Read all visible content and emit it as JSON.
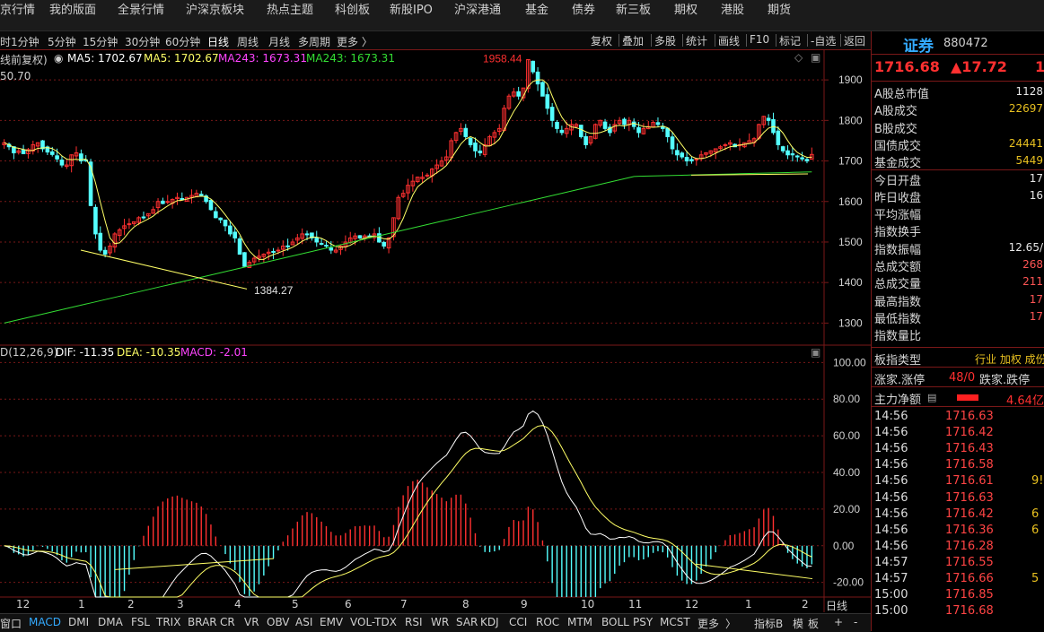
{
  "top_nav": [
    "京行情",
    "我的版面",
    "全景行情",
    "沪深京板块",
    "热点主题",
    "科创板",
    "新股IPO",
    "沪深港通",
    "基金",
    "债券",
    "新三板",
    "期权",
    "港股",
    "期货"
  ],
  "periods": [
    "时",
    "1分钟",
    "5分钟",
    "15分钟",
    "30分钟",
    "60分钟",
    "日线",
    "周线",
    "月线",
    "多周期",
    "更多 〉"
  ],
  "active_period": "日线",
  "tools": [
    "复权",
    "叠加",
    "多股",
    "统计",
    "画线",
    "F10",
    "标记",
    "-自选",
    "返回"
  ],
  "legend": {
    "fq": "线前复权)",
    "ma5a": "MA5: 1702.67",
    "ma5b": "MA5: 1702.67",
    "ma243a": "MA243: 1673.31",
    "ma243b": "MA243: 1673.31",
    "top_value": "50.70",
    "high_mark": "1958.44",
    "low_mark": "1384.27"
  },
  "macd_legend": {
    "name": "D(12,26,9)",
    "dif": "DIF: -11.35",
    "dea": "DEA: -10.35",
    "macd": "MACD: -2.01"
  },
  "price_axis": [
    "1900",
    "1800",
    "1700",
    "1600",
    "1500",
    "1400",
    "1300"
  ],
  "macd_axis": [
    "100.00",
    "80.00",
    "60.00",
    "40.00",
    "20.00",
    "0.00",
    "-20.00"
  ],
  "x_labels": [
    "12",
    "1",
    "2",
    "3",
    "4",
    "5",
    "6",
    "7",
    "8",
    "9",
    "10",
    "11",
    "12",
    "1",
    "2"
  ],
  "right_panel": {
    "name": "证券",
    "code": "880472",
    "price": "1716.68",
    "change": "▲17.72",
    "change_pct": "1",
    "rows": [
      {
        "label": "A股总市值",
        "value": "1128"
      },
      {
        "label": "A股成交",
        "value": "22697"
      },
      {
        "label": "B股成交",
        "value": ""
      },
      {
        "label": "国债成交",
        "value": "24441"
      },
      {
        "label": "基金成交",
        "value": "5449"
      },
      {
        "label": "今日开盘",
        "value": "17"
      },
      {
        "label": "昨日收盘",
        "value": "16"
      },
      {
        "label": "平均涨幅",
        "value": ""
      },
      {
        "label": "指数换手",
        "value": ""
      },
      {
        "label": "指数振幅",
        "value": "12.65/"
      },
      {
        "label": "总成交额",
        "value": "268"
      },
      {
        "label": "总成交量",
        "value": "211"
      },
      {
        "label": "最高指数",
        "value": "17"
      },
      {
        "label": "最低指数",
        "value": "17"
      },
      {
        "label": "指数量比",
        "value": ""
      }
    ],
    "sector_type_label": "板指类型",
    "sector_type_value": "行业 加权 成份",
    "up_label": "涨家.涨停",
    "up_value": "48/0",
    "down_label": "跌家.跌停",
    "netflow_label": "主力净额",
    "netflow_value": "4.64亿",
    "ticks": [
      {
        "time": "14:56",
        "price": "1716.63",
        "vol": ""
      },
      {
        "time": "14:56",
        "price": "1716.42",
        "vol": ""
      },
      {
        "time": "14:56",
        "price": "1716.43",
        "vol": ""
      },
      {
        "time": "14:56",
        "price": "1716.58",
        "vol": ""
      },
      {
        "time": "14:56",
        "price": "1716.61",
        "vol": "9!"
      },
      {
        "time": "14:56",
        "price": "1716.63",
        "vol": ""
      },
      {
        "time": "14:56",
        "price": "1716.42",
        "vol": "6"
      },
      {
        "time": "14:56",
        "price": "1716.36",
        "vol": "6"
      },
      {
        "time": "14:56",
        "price": "1716.28",
        "vol": ""
      },
      {
        "time": "14:57",
        "price": "1716.55",
        "vol": ""
      },
      {
        "time": "14:57",
        "price": "1716.66",
        "vol": "5"
      },
      {
        "time": "15:00",
        "price": "1716.85",
        "vol": ""
      },
      {
        "time": "15:00",
        "price": "1716.68",
        "vol": ""
      }
    ]
  },
  "bottom_tabs": [
    "窗口",
    "MACD",
    "DMI",
    "DMA",
    "FSL",
    "TRIX",
    "BRAR",
    "CR",
    "VR",
    "OBV",
    "ASI",
    "EMV",
    "VOL-TDX",
    "RSI",
    "WR",
    "SAR",
    "KDJ",
    "CCI",
    "ROC",
    "MTM",
    "BOLL",
    "PSY",
    "MCST",
    "更多",
    "〉",
    "指标B",
    "模",
    "板",
    "+",
    "-"
  ],
  "active_tab": "MACD",
  "bottom_right_label": "日线",
  "colors": {
    "up": "#ff3030",
    "down": "#54ffff",
    "ma5": "#ffff66",
    "ma243": "#33dd33",
    "dea": "#ffff66",
    "dif": "#ffffff",
    "grid": "#7a1818"
  },
  "chart_data": {
    "type": "candlestick",
    "title": "",
    "ylim": [
      1250,
      1960
    ],
    "close": [
      1745,
      1735,
      1720,
      1725,
      1718,
      1728,
      1740,
      1745,
      1730,
      1722,
      1716,
      1705,
      1690,
      1690,
      1715,
      1720,
      1700,
      1700,
      1590,
      1520,
      1480,
      1470,
      1490,
      1520,
      1530,
      1540,
      1545,
      1550,
      1560,
      1560,
      1570,
      1580,
      1600,
      1595,
      1600,
      1605,
      1610,
      1605,
      1610,
      1615,
      1620,
      1615,
      1600,
      1580,
      1560,
      1555,
      1540,
      1520,
      1510,
      1470,
      1440,
      1450,
      1460,
      1465,
      1470,
      1475,
      1475,
      1480,
      1490,
      1490,
      1500,
      1510,
      1520,
      1520,
      1510,
      1500,
      1495,
      1490,
      1480,
      1480,
      1490,
      1500,
      1510,
      1515,
      1510,
      1515,
      1515,
      1520,
      1500,
      1490,
      1510,
      1560,
      1610,
      1620,
      1640,
      1650,
      1660,
      1660,
      1665,
      1680,
      1690,
      1700,
      1710,
      1750,
      1770,
      1780,
      1760,
      1740,
      1725,
      1720,
      1740,
      1760,
      1770,
      1780,
      1830,
      1860,
      1870,
      1860,
      1880,
      1950,
      1920,
      1890,
      1860,
      1830,
      1800,
      1780,
      1770,
      1780,
      1790,
      1790,
      1760,
      1740,
      1760,
      1790,
      1800,
      1780,
      1770,
      1790,
      1800,
      1790,
      1800,
      1785,
      1770,
      1780,
      1785,
      1795,
      1790,
      1780,
      1760,
      1730,
      1715,
      1710,
      1700,
      1700,
      1705,
      1715,
      1720,
      1725,
      1730,
      1735,
      1740,
      1745,
      1735,
      1740,
      1745,
      1750,
      1755,
      1790,
      1810,
      1800,
      1770,
      1740,
      1725,
      1715,
      1715,
      1710,
      1705,
      1700,
      1716
    ]
  }
}
